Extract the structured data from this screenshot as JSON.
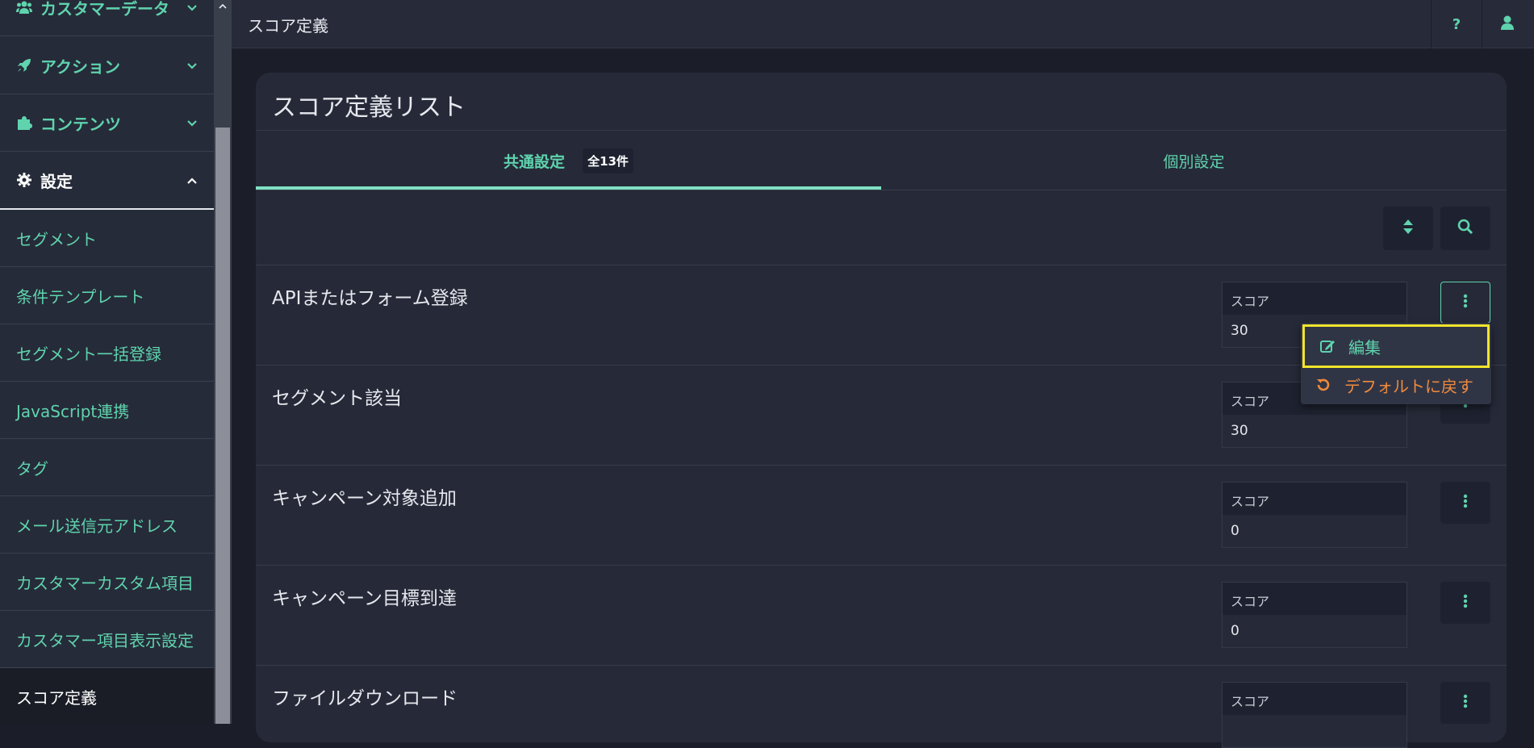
{
  "colors": {
    "accent": "#5fd3ad",
    "reset": "#f08a3c",
    "highlight": "#f2e52a"
  },
  "sidebar": {
    "groups": [
      {
        "label": "カスタマーデータ",
        "icon": "users-icon",
        "expanded": false
      },
      {
        "label": "アクション",
        "icon": "rocket-icon",
        "expanded": false
      },
      {
        "label": "コンテンツ",
        "icon": "puzzle-icon",
        "expanded": false
      },
      {
        "label": "設定",
        "icon": "gear-icon",
        "expanded": true
      }
    ],
    "items": [
      {
        "label": "セグメント"
      },
      {
        "label": "条件テンプレート"
      },
      {
        "label": "セグメント一括登録"
      },
      {
        "label": "JavaScript連携"
      },
      {
        "label": "タグ"
      },
      {
        "label": "メール送信元アドレス"
      },
      {
        "label": "カスタマーカスタム項目"
      },
      {
        "label": "カスタマー項目表示設定"
      },
      {
        "label": "スコア定義",
        "active": true
      }
    ]
  },
  "topbar": {
    "title": "スコア定義",
    "help_label": "?",
    "user_icon": "user-icon"
  },
  "panel": {
    "title": "スコア定義リスト",
    "tabs": [
      {
        "label": "共通設定",
        "badge": "全13件",
        "active": true
      },
      {
        "label": "個別設定",
        "active": false
      }
    ],
    "toolbar": {
      "sort_icon": "sort-icon",
      "search_icon": "search-icon"
    },
    "rows": [
      {
        "name": "APIまたはフォーム登録",
        "score_label": "スコア",
        "score": "30"
      },
      {
        "name": "セグメント該当",
        "score_label": "スコア",
        "score": "30"
      },
      {
        "name": "キャンペーン対象追加",
        "score_label": "スコア",
        "score": "0"
      },
      {
        "name": "キャンペーン目標到達",
        "score_label": "スコア",
        "score": "0"
      },
      {
        "name": "ファイルダウンロード",
        "score_label": "スコア",
        "score": ""
      }
    ]
  },
  "dropdown": {
    "items": [
      {
        "label": "編集",
        "icon": "edit-icon"
      },
      {
        "label": "デフォルトに戻す",
        "icon": "undo-icon"
      }
    ]
  }
}
